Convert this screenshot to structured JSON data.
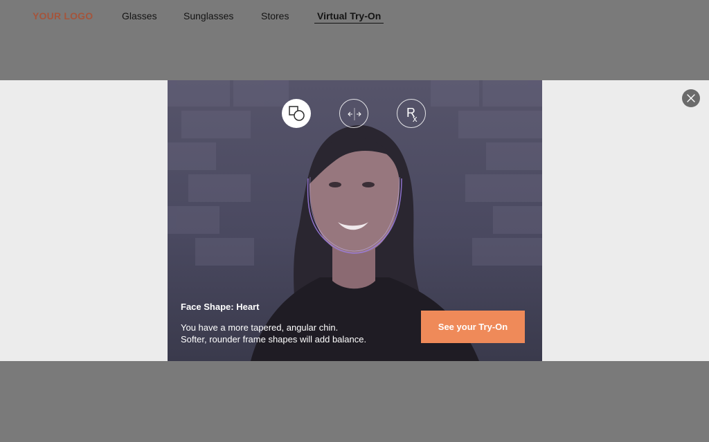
{
  "header": {
    "logo": "YOUR LOGO",
    "nav": [
      {
        "label": "Glasses"
      },
      {
        "label": "Sunglasses"
      },
      {
        "label": "Stores"
      },
      {
        "label": "Virtual Try-On"
      }
    ],
    "active_nav": "Virtual Try-On"
  },
  "modal": {
    "steps": [
      {
        "icon": "face-shape-icon",
        "active": true
      },
      {
        "icon": "measure-arrows-icon",
        "active": false
      },
      {
        "icon": "prescription-rx-icon",
        "active": false
      }
    ],
    "rx_symbol": "Rx",
    "face_shape_title": "Face Shape: Heart",
    "description_line1": "You have a more tapered, angular chin.",
    "description_line2": "Softer, rounder frame shapes will add balance.",
    "cta_label": "See your Try-On",
    "close_icon": "close-icon"
  },
  "colors": {
    "accent": "#ef8a59",
    "logo": "#a4553c",
    "overlay": "#7a7a7a",
    "band": "#ececec"
  }
}
